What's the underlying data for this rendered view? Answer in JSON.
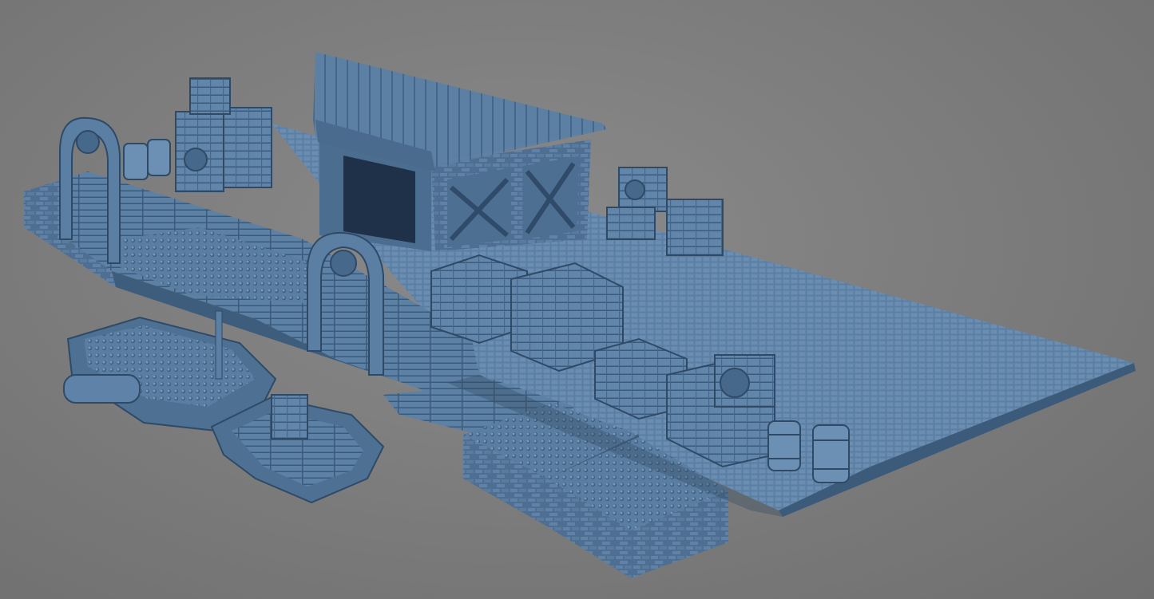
{
  "scene": {
    "background_color": "#7d7d7d",
    "model_color": "#5a7fa4",
    "model_shadow": "#2f4a66",
    "model_highlight": "#86a6c6",
    "objects": [
      "dock-floor-tile-grid",
      "warehouse-building",
      "gateway-arch",
      "wooden-walkway",
      "crate-stack",
      "barrel",
      "small-boat",
      "rowboat",
      "stone-block-platform"
    ]
  }
}
